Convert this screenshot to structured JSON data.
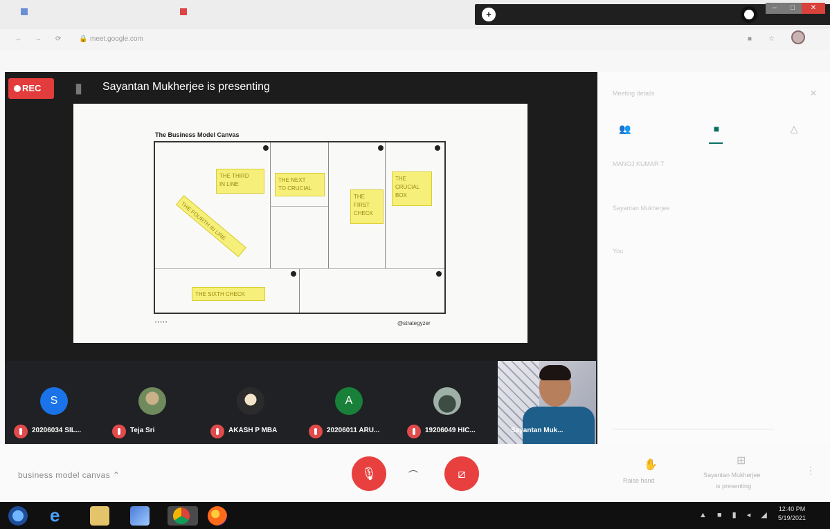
{
  "browser": {
    "tabs": [
      "",
      ""
    ],
    "new_tab_symbol": "+",
    "url": "meet.google.com"
  },
  "window_controls": {
    "minimize": "–",
    "maximize": "□",
    "close": "✕"
  },
  "meeting": {
    "rec_label": "REC",
    "presenting_text": "Sayantan Mukherjee is presenting",
    "meeting_name": "business model canvas"
  },
  "slide": {
    "title": "The Business Model Canvas",
    "footer": "@strategyzer",
    "notes": [
      {
        "text": "THE THIRD\nIN LINE"
      },
      {
        "text": "THE NEXT\nTO CRUCIAL"
      },
      {
        "text": "THE\nFIRST\nCHECK"
      },
      {
        "text": "THE\nCRUCIAL\nBOX"
      },
      {
        "text": "THE FOURTH IN LINE"
      },
      {
        "text": "THE SIXTH CHECK"
      }
    ]
  },
  "participants": [
    {
      "name": "20206034 SIL...",
      "initial": "S",
      "color": "#1a73e8"
    },
    {
      "name": "Teja Sri",
      "initial": "",
      "color": "#8a7a6a"
    },
    {
      "name": "AKASH P MBA",
      "initial": "",
      "color": "#ddd"
    },
    {
      "name": "20206011 ARU...",
      "initial": "A",
      "color": "#188038"
    },
    {
      "name": "19206049 HIC...",
      "initial": "",
      "color": "#6f7f78"
    }
  ],
  "self_view": {
    "name": "Sayantan Muk..."
  },
  "right_panel": {
    "header": "Meeting details",
    "messages": [
      {
        "sender": "MANOJ KUMAR T",
        "text": ""
      },
      {
        "sender": "Sayantan Mukherjee",
        "text": ""
      },
      {
        "sender": "You",
        "text": ""
      }
    ]
  },
  "bottom": {
    "raise_hand": "Raise hand",
    "present_label": "Sayantan Mukherjee",
    "present_sub": "is presenting"
  },
  "taskbar": {
    "time": "12:40 PM",
    "date": "5/19/2021"
  },
  "colors": {
    "rec_red": "#e23c3c",
    "control_red": "#e8403e",
    "accent_teal": "#0a6e62",
    "note_yellow": "#f6f07a"
  }
}
